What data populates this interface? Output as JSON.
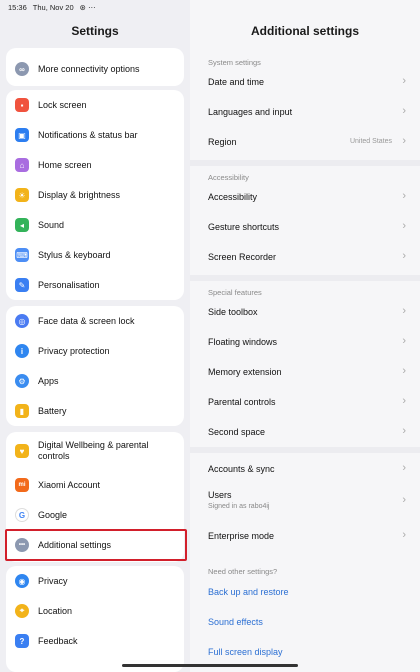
{
  "status": {
    "time": "15:36",
    "date": "Thu, Nov 20",
    "dots": "•••",
    "battery": "83"
  },
  "left": {
    "title": "Settings",
    "groups": [
      [
        {
          "label": "More connectivity options",
          "icon": "link-icon",
          "color": "#8c98b0",
          "glyph": "∞"
        }
      ],
      [
        {
          "label": "Lock screen",
          "icon": "lock-icon",
          "color": "#f0533e",
          "glyph": "▪"
        },
        {
          "label": "Notifications & status bar",
          "icon": "notification-icon",
          "color": "#2d7ef0",
          "glyph": "▣"
        },
        {
          "label": "Home screen",
          "icon": "home-icon",
          "color": "#a96de0",
          "glyph": "⌂"
        },
        {
          "label": "Display & brightness",
          "icon": "sun-icon",
          "color": "#f2b31a",
          "glyph": "☀"
        },
        {
          "label": "Sound",
          "icon": "speaker-icon",
          "color": "#33b35a",
          "glyph": "◂"
        },
        {
          "label": "Stylus & keyboard",
          "icon": "keyboard-icon",
          "color": "#4d8ef5",
          "glyph": "⌨"
        },
        {
          "label": "Personalisation",
          "icon": "brush-icon",
          "color": "#3a7ff2",
          "glyph": "✎"
        }
      ],
      [
        {
          "label": "Face data & screen lock",
          "icon": "fingerprint-icon",
          "color": "#4a7bf2",
          "glyph": "◎"
        },
        {
          "label": "Privacy protection",
          "icon": "privacy-icon",
          "color": "#2f86f0",
          "glyph": "i"
        },
        {
          "label": "Apps",
          "icon": "apps-icon",
          "color": "#3a8cf0",
          "glyph": "⚙"
        },
        {
          "label": "Battery",
          "icon": "battery-icon",
          "color": "#f2b31a",
          "glyph": "▮"
        }
      ],
      [
        {
          "label": "Digital Wellbeing & parental controls",
          "icon": "wellbeing-icon",
          "color": "#f2b31a",
          "glyph": "♥"
        },
        {
          "label": "Xiaomi Account",
          "icon": "mi-icon",
          "color": "#f26a1b",
          "glyph": "mi"
        },
        {
          "label": "Google",
          "icon": "google-icon",
          "color": "#ffffff",
          "glyph": "G"
        },
        {
          "label": "Additional settings",
          "icon": "more-icon",
          "color": "#8c98b0",
          "glyph": "•••"
        }
      ],
      [
        {
          "label": "Privacy",
          "icon": "eye-icon",
          "color": "#2f86f0",
          "glyph": "◉"
        },
        {
          "label": "Location",
          "icon": "location-icon",
          "color": "#f2b31a",
          "glyph": "⌖"
        },
        {
          "label": "Feedback",
          "icon": "feedback-icon",
          "color": "#3a7ff2",
          "glyph": "?"
        }
      ]
    ]
  },
  "right": {
    "title": "Additional settings",
    "sections": [
      {
        "header": "System settings",
        "items": [
          {
            "label": "Date and time"
          },
          {
            "label": "Languages and input"
          },
          {
            "label": "Region",
            "value": "United States"
          }
        ]
      },
      {
        "header": "Accessibility",
        "items": [
          {
            "label": "Accessibility"
          },
          {
            "label": "Gesture shortcuts"
          },
          {
            "label": "Screen Recorder"
          }
        ]
      },
      {
        "header": "Special features",
        "items": [
          {
            "label": "Side toolbox"
          },
          {
            "label": "Floating windows"
          },
          {
            "label": "Memory extension"
          },
          {
            "label": "Parental controls"
          },
          {
            "label": "Second space"
          }
        ]
      },
      {
        "header": "",
        "items": [
          {
            "label": "Accounts & sync"
          },
          {
            "label": "Users",
            "sub": "Signed in as rabo4ij"
          },
          {
            "label": "Enterprise mode"
          }
        ]
      },
      {
        "header": "Need other settings?",
        "items": [
          {
            "label": "Back up and restore",
            "link": true
          },
          {
            "label": "Sound effects",
            "link": true
          },
          {
            "label": "Full screen display",
            "link": true
          }
        ]
      }
    ]
  }
}
